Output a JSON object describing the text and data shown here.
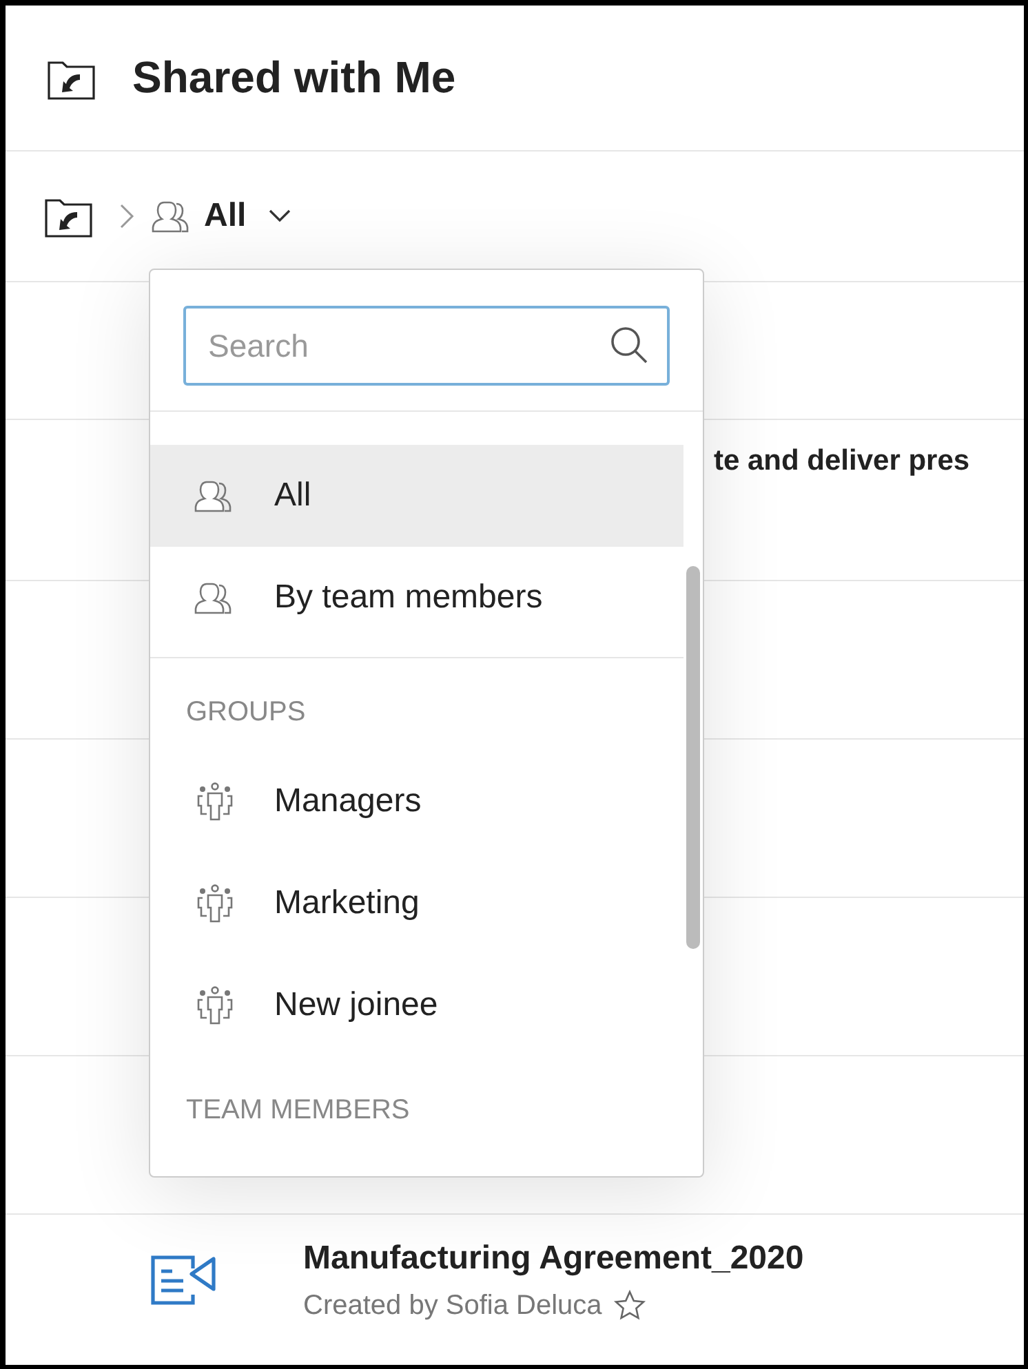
{
  "header": {
    "title": "Shared with Me"
  },
  "breadcrumb": {
    "current": "All"
  },
  "rows": [
    {
      "kind": "partial",
      "title": "te and deliver pres"
    },
    {
      "kind": "document",
      "title": "Manufacturing Agreement_2020",
      "subtitle": "Created by Sofia Deluca",
      "starred": false
    }
  ],
  "dropdown": {
    "search": {
      "placeholder": "Search"
    },
    "sections": [
      {
        "items": [
          {
            "label": "All",
            "selected": true
          },
          {
            "label": "By team members",
            "selected": false
          }
        ]
      },
      {
        "heading": "GROUPS",
        "items": [
          {
            "label": "Managers",
            "selected": false
          },
          {
            "label": "Marketing",
            "selected": false
          },
          {
            "label": "New joinee",
            "selected": false
          }
        ]
      },
      {
        "heading": "TEAM MEMBERS"
      }
    ]
  }
}
